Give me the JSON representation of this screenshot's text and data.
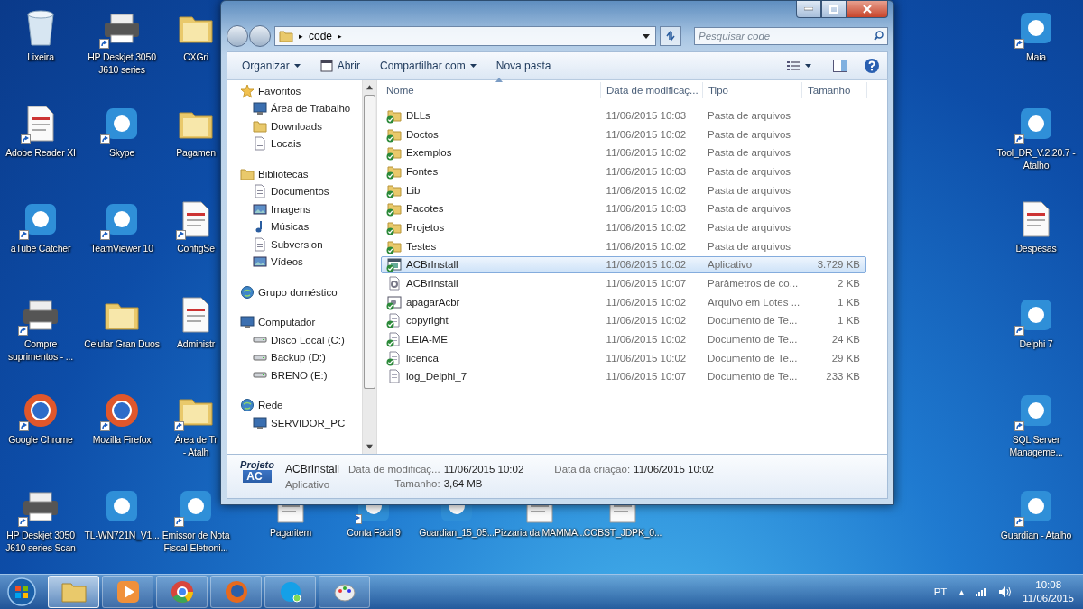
{
  "desktop": {
    "left_columns": [
      [
        {
          "label": "Lixeira",
          "kind": "bin",
          "shortcut": false
        },
        {
          "label": "Adobe Reader XI",
          "kind": "document",
          "shortcut": true
        },
        {
          "label": "aTube Catcher",
          "kind": "app",
          "shortcut": true
        },
        {
          "label": "Compre suprimentos - ...",
          "kind": "device",
          "shortcut": true
        },
        {
          "label": "Google Chrome",
          "kind": "browser",
          "shortcut": true
        },
        {
          "label": "HP Deskjet 3050 J610 series Scan",
          "kind": "device",
          "shortcut": true
        }
      ],
      [
        {
          "label": "HP Deskjet 3050 J610 series",
          "kind": "device",
          "shortcut": true
        },
        {
          "label": "Skype",
          "kind": "app",
          "shortcut": true
        },
        {
          "label": "TeamViewer 10",
          "kind": "app",
          "shortcut": true
        },
        {
          "label": "Celular Gran Duos",
          "kind": "folder",
          "shortcut": false
        },
        {
          "label": "Mozilla Firefox",
          "kind": "browser",
          "shortcut": true
        },
        {
          "label": "TL-WN721N_V1...",
          "kind": "app",
          "shortcut": false
        }
      ],
      [
        {
          "label": "CXGri",
          "kind": "folder",
          "shortcut": false
        },
        {
          "label": "Pagamen",
          "kind": "folder",
          "shortcut": false
        },
        {
          "label": "ConfigSe",
          "kind": "document",
          "shortcut": true
        },
        {
          "label": "Administr",
          "kind": "document",
          "shortcut": false
        },
        {
          "label": "Área de Tr\n- Atalh",
          "kind": "folder",
          "shortcut": true
        },
        {
          "label": "Emissor de Nota Fiscal Eletroni...",
          "kind": "app",
          "shortcut": true
        }
      ]
    ],
    "bottom_row": [
      {
        "label": "Pagaritem",
        "kind": "document",
        "shortcut": false
      },
      {
        "label": "Conta Fácil 9",
        "kind": "app",
        "shortcut": true
      },
      {
        "label": "Guardian_15_05...",
        "kind": "app",
        "shortcut": false
      },
      {
        "label": "Pizzaria da MAMMA...",
        "kind": "document",
        "shortcut": false
      },
      {
        "label": "COBST_JDPK_0...",
        "kind": "document",
        "shortcut": false
      }
    ],
    "right_column": [
      {
        "label": "Maia",
        "kind": "app",
        "shortcut": true
      },
      {
        "label": "Tool_DR_V.2.20.7 - Atalho",
        "kind": "app",
        "shortcut": true
      },
      {
        "label": "Despesas",
        "kind": "document",
        "shortcut": false
      },
      {
        "label": "Delphi 7",
        "kind": "app",
        "shortcut": true
      },
      {
        "label": "SQL Server Manageme...",
        "kind": "app",
        "shortcut": true
      },
      {
        "label": "Guardian - Atalho",
        "kind": "app",
        "shortcut": true
      }
    ]
  },
  "explorer": {
    "address": {
      "path": "code",
      "separator_before": "▸",
      "separator_after": "▸"
    },
    "search": {
      "placeholder": "Pesquisar code"
    },
    "toolbar": [
      {
        "label": "Organizar",
        "dropdown": true,
        "icon": false
      },
      {
        "label": "Abrir",
        "dropdown": false,
        "icon": true
      },
      {
        "label": "Compartilhar com",
        "dropdown": true,
        "icon": false
      },
      {
        "label": "Nova pasta",
        "dropdown": false,
        "icon": false
      }
    ],
    "navigation": [
      {
        "label": "Favoritos",
        "kind": "star",
        "children": [
          {
            "label": "Área de Trabalho",
            "kind": "monitor"
          },
          {
            "label": "Downloads",
            "kind": "folder"
          },
          {
            "label": "Locais",
            "kind": "document"
          }
        ]
      },
      {
        "label": "Bibliotecas",
        "kind": "folder",
        "children": [
          {
            "label": "Documentos",
            "kind": "document"
          },
          {
            "label": "Imagens",
            "kind": "picture"
          },
          {
            "label": "Músicas",
            "kind": "music"
          },
          {
            "label": "Subversion",
            "kind": "document"
          },
          {
            "label": "Vídeos",
            "kind": "picture"
          }
        ]
      },
      {
        "label": "Grupo doméstico",
        "kind": "network"
      },
      {
        "label": "Computador",
        "kind": "monitor",
        "children": [
          {
            "label": "Disco Local (C:)",
            "kind": "drive"
          },
          {
            "label": "Backup (D:)",
            "kind": "drive"
          },
          {
            "label": "BRENO (E:)",
            "kind": "drive"
          }
        ]
      },
      {
        "label": "Rede",
        "kind": "network",
        "children": [
          {
            "label": "SERVIDOR_PC",
            "kind": "monitor"
          }
        ]
      }
    ],
    "columns": [
      "Nome",
      "Data de modificaç...",
      "Tipo",
      "Tamanho"
    ],
    "files": [
      {
        "name": "DLLs",
        "modified": "11/06/2015 10:03",
        "type": "Pasta de arquivos",
        "kind": "folder",
        "versioned": true,
        "selected": false
      },
      {
        "name": "Doctos",
        "modified": "11/06/2015 10:02",
        "type": "Pasta de arquivos",
        "kind": "folder",
        "versioned": true,
        "selected": false
      },
      {
        "name": "Exemplos",
        "modified": "11/06/2015 10:02",
        "type": "Pasta de arquivos",
        "kind": "folder",
        "versioned": true,
        "selected": false
      },
      {
        "name": "Fontes",
        "modified": "11/06/2015 10:03",
        "type": "Pasta de arquivos",
        "kind": "folder",
        "versioned": true,
        "selected": false
      },
      {
        "name": "Lib",
        "modified": "11/06/2015 10:02",
        "type": "Pasta de arquivos",
        "kind": "folder",
        "versioned": true,
        "selected": false
      },
      {
        "name": "Pacotes",
        "modified": "11/06/2015 10:03",
        "type": "Pasta de arquivos",
        "kind": "folder",
        "versioned": true,
        "selected": false
      },
      {
        "name": "Projetos",
        "modified": "11/06/2015 10:02",
        "type": "Pasta de arquivos",
        "kind": "folder",
        "versioned": true,
        "selected": false
      },
      {
        "name": "Testes",
        "modified": "11/06/2015 10:02",
        "type": "Pasta de arquivos",
        "kind": "folder",
        "versioned": true,
        "selected": false
      },
      {
        "name": "ACBrInstall",
        "modified": "11/06/2015 10:02",
        "type": "Aplicativo",
        "size": "3.729 KB",
        "kind": "app",
        "versioned": true,
        "selected": true
      },
      {
        "name": "ACBrInstall",
        "modified": "11/06/2015 10:07",
        "type": "Parâmetros de co...",
        "size": "2 KB",
        "kind": "settings",
        "versioned": false,
        "selected": false
      },
      {
        "name": "apagarAcbr",
        "modified": "11/06/2015 10:02",
        "type": "Arquivo em Lotes ...",
        "size": "1 KB",
        "kind": "batch",
        "versioned": true,
        "selected": false
      },
      {
        "name": "copyright",
        "modified": "11/06/2015 10:02",
        "type": "Documento de Te...",
        "size": "1 KB",
        "kind": "text",
        "versioned": true,
        "selected": false
      },
      {
        "name": "LEIA-ME",
        "modified": "11/06/2015 10:02",
        "type": "Documento de Te...",
        "size": "24 KB",
        "kind": "text",
        "versioned": true,
        "selected": false
      },
      {
        "name": "licenca",
        "modified": "11/06/2015 10:02",
        "type": "Documento de Te...",
        "size": "29 KB",
        "kind": "text",
        "versioned": true,
        "selected": false
      },
      {
        "name": "log_Delphi_7",
        "modified": "11/06/2015 10:07",
        "type": "Documento de Te...",
        "size": "233 KB",
        "kind": "text",
        "versioned": false,
        "selected": false
      }
    ],
    "details": {
      "thumbnail_title": "Projeto",
      "thumbnail_logo": "AC",
      "name": "ACBrInstall",
      "type": "Aplicativo",
      "fields": [
        {
          "label": "Data de modificaç...",
          "value": "11/06/2015 10:02"
        },
        {
          "label": "Tamanho:",
          "value": "3,64 MB"
        },
        {
          "label": "Data da criação:",
          "value": "11/06/2015 10:02"
        }
      ]
    }
  },
  "taskbar": {
    "items": [
      {
        "kind": "folder",
        "selected": true
      },
      {
        "kind": "media",
        "selected": false
      },
      {
        "kind": "chrome",
        "selected": false
      },
      {
        "kind": "firefox",
        "selected": false
      },
      {
        "kind": "chat",
        "selected": false
      },
      {
        "kind": "paint",
        "selected": false
      }
    ],
    "language": "PT",
    "tray_arrow": "▲",
    "time": "10:08",
    "date": "11/06/2015"
  }
}
